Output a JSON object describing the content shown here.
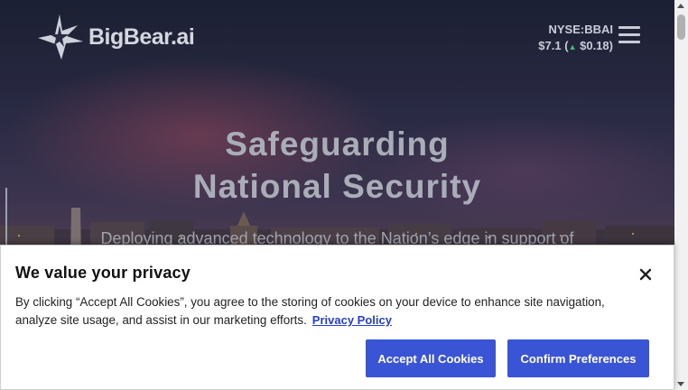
{
  "header": {
    "logo_text": "BigBear.ai",
    "ticker_symbol": "NYSE:BBAI",
    "ticker_price": "$7.1",
    "ticker_change": "$0.18",
    "ticker_change_direction": "up",
    "menu_icon": "hamburger-menu-icon"
  },
  "hero": {
    "title_line1": "Safeguarding",
    "title_line2": "National Security",
    "subtitle": "Deploying advanced technology to the Nation’s edge in support of"
  },
  "cookie_banner": {
    "title": "We value your privacy",
    "body": "By clicking “Accept All Cookies”, you agree to the storing of cookies on your device to enhance site navigation, analyze site usage, and assist in our marketing efforts.",
    "privacy_link": "Privacy Policy",
    "accept_label": "Accept All Cookies",
    "confirm_label": "Confirm Preferences",
    "close_icon": "close-icon"
  },
  "colors": {
    "button_bg": "#3a54d6",
    "link": "#2540c8",
    "ticker_up": "#3cc37a"
  }
}
